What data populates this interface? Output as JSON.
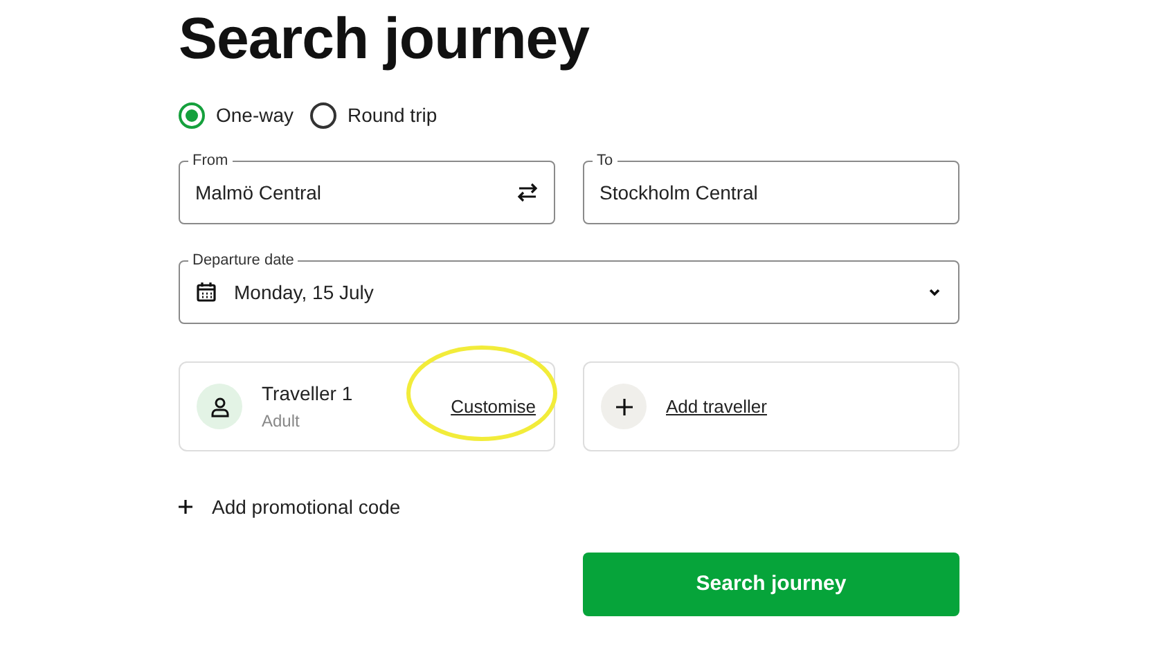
{
  "title": "Search journey",
  "trip_types": [
    {
      "label": "One-way",
      "selected": true
    },
    {
      "label": "Round trip",
      "selected": false
    }
  ],
  "from": {
    "label": "From",
    "value": "Malmö Central"
  },
  "to": {
    "label": "To",
    "value": "Stockholm Central"
  },
  "departure": {
    "label": "Departure date",
    "value": "Monday, 15 July"
  },
  "traveller": {
    "name": "Traveller 1",
    "type": "Adult",
    "action": "Customise"
  },
  "add_traveller": "Add traveller",
  "promo": "Add promotional code",
  "submit": "Search journey"
}
